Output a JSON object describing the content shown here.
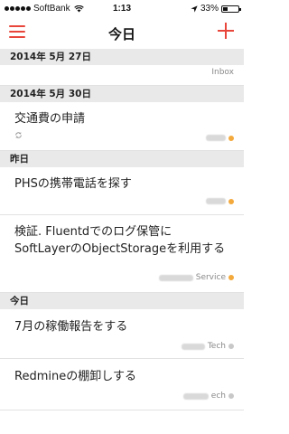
{
  "status_bar": {
    "carrier": "SoftBank",
    "time": "1:13",
    "battery": "33%",
    "battery_level": 0.33
  },
  "nav": {
    "title": "今日"
  },
  "colors": {
    "accent": "#e8463b",
    "dot_orange": "#f3a93c",
    "dot_gray": "#c8c8c8",
    "section_bg": "#e9e9e9"
  },
  "sections": [
    {
      "header": "2014年 5月 27日",
      "tasks": [
        {
          "title": "",
          "meta": "Inbox"
        }
      ]
    },
    {
      "header": "2014年 5月 30日",
      "tasks": [
        {
          "title": "交通費の申請",
          "meta": ""
        }
      ]
    },
    {
      "header": "昨日",
      "tasks": [
        {
          "title": "PHSの携帯電話を探す",
          "meta": ""
        },
        {
          "title_line1": "検証. Fluentdでのログ保管に",
          "title_line2": "SoftLayerのObjectStorageを利用する",
          "meta": "Service"
        }
      ]
    },
    {
      "header": "今日",
      "tasks": [
        {
          "title": "7月の稼働報告をする",
          "meta": "Tech"
        },
        {
          "title": "Redmineの棚卸しする",
          "meta": "ech"
        }
      ]
    }
  ]
}
